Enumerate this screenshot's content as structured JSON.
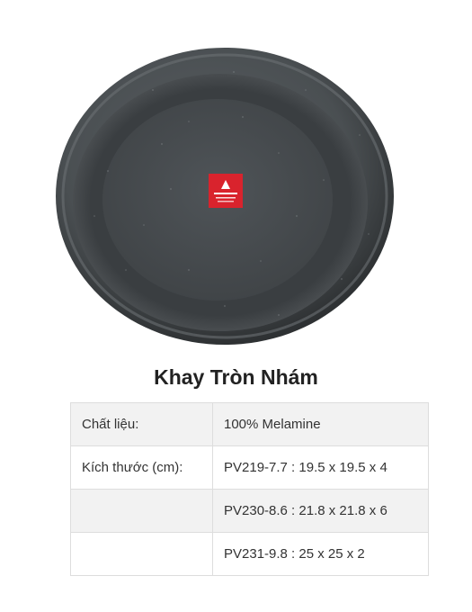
{
  "product": {
    "title": "Khay Tròn Nhám",
    "image_alt": "round matte tray",
    "badge_text": "Superware"
  },
  "specs": {
    "rows": [
      {
        "label": "Chất liệu:",
        "value": "100% Melamine"
      },
      {
        "label": "Kích thước (cm):",
        "value": "PV219-7.7 : 19.5 x 19.5 x 4"
      },
      {
        "label": "",
        "value": "PV230-8.6 : 21.8 x 21.8 x 6"
      },
      {
        "label": "",
        "value": "PV231-9.8 : 25 x 25 x 2"
      }
    ]
  },
  "colors": {
    "tray": "#45494c",
    "badge": "#d9232d",
    "table_border": "#dddddd",
    "row_shade": "#f2f2f2"
  }
}
